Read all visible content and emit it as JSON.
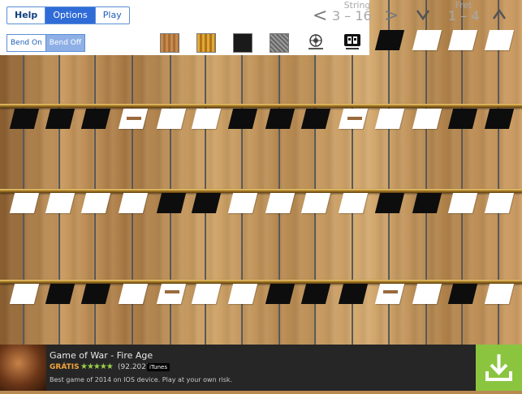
{
  "top_menu": {
    "help": "Help",
    "options": "Options",
    "play": "Play",
    "active": "Options"
  },
  "bend": {
    "on": "Bend On",
    "off": "Bend Off",
    "active": "Bend Off"
  },
  "textures": [
    "light-wood-texture",
    "golden-wood-texture",
    "black-texture",
    "gray-metal-texture",
    "maestro-logo-icon",
    "pa-logo-icon"
  ],
  "string_range": {
    "label": "String",
    "value": "3 – 16"
  },
  "fret_range": {
    "label": "Fret",
    "value": "1 – 4"
  },
  "ad": {
    "title": "Game of War - Fire Age",
    "price": "GRÁTIS",
    "stars": "★★★★★",
    "rating_count": "(92.202)",
    "badge": "iTunes",
    "description": "Best game of 2014 on IOS device. Play at your own risk."
  },
  "colors": {
    "accent": "#2f6cd8",
    "ad_bar": "#262626",
    "download": "#8bc540",
    "price": "#f2a43a"
  }
}
